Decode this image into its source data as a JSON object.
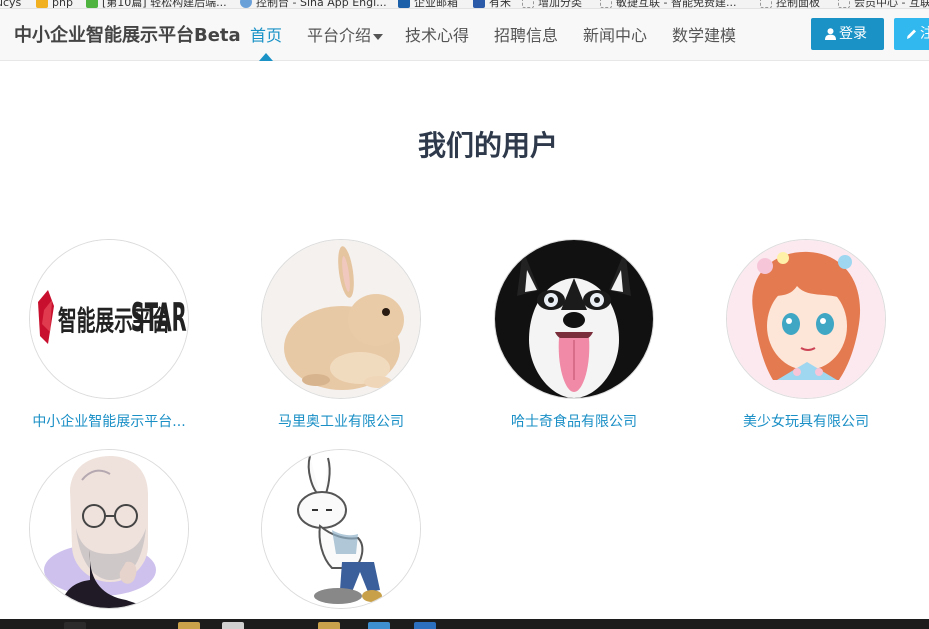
{
  "bookmarks": [
    {
      "label": "ucys",
      "color": "#888888"
    },
    {
      "label": "php",
      "color": "#f0b020"
    },
    {
      "label": "[第10篇] 轻松构建后端...",
      "color": "#4fb340"
    },
    {
      "label": "控制台 - Sina App Engi...",
      "color": "#6aa0d8"
    },
    {
      "label": "企业邮箱",
      "color": "#1a5fa8"
    },
    {
      "label": "有米",
      "color": "#2b5aa8"
    },
    {
      "label": "增加分类",
      "color": "#dddddd"
    },
    {
      "label": "敏捷互联 - 智能免费建...",
      "color": "#dddddd"
    },
    {
      "label": "控制面板",
      "color": "#dddddd"
    },
    {
      "label": "会员中心 - 互联",
      "color": "#dddddd"
    }
  ],
  "navbar": {
    "brand": "中小企业智能展示平台Beta",
    "items": [
      {
        "label": "首页",
        "active": true
      },
      {
        "label": "平台介绍",
        "dropdown": true
      },
      {
        "label": "技术心得"
      },
      {
        "label": "招聘信息"
      },
      {
        "label": "新闻中心"
      },
      {
        "label": "数学建模"
      }
    ],
    "login_label": "登录",
    "register_label": "注册"
  },
  "section": {
    "title": "我们的用户"
  },
  "users": [
    {
      "name": "中小企业智能展示平台...",
      "avatar": "logo-stark",
      "logo_text_cn": "智能展示平台",
      "logo_text_en": "STARK"
    },
    {
      "name": "马里奥工业有限公司",
      "avatar": "rabbit"
    },
    {
      "name": "哈士奇食品有限公司",
      "avatar": "husky"
    },
    {
      "name": "美少女玩具有限公司",
      "avatar": "anime-girl"
    },
    {
      "name": "",
      "avatar": "steve-jobs"
    },
    {
      "name": "",
      "avatar": "cartoon-rabbit"
    }
  ],
  "colors": {
    "accent": "#1a92c6",
    "register": "#31b8ee",
    "title": "#2e3a4b",
    "link": "#1a8fc6"
  },
  "taskbar": {
    "items": [
      "#2b2b2b",
      "#caa24a",
      "#d0d0d0",
      "#c9a24b",
      "#3d8fcf",
      "#2d6fbf"
    ]
  }
}
